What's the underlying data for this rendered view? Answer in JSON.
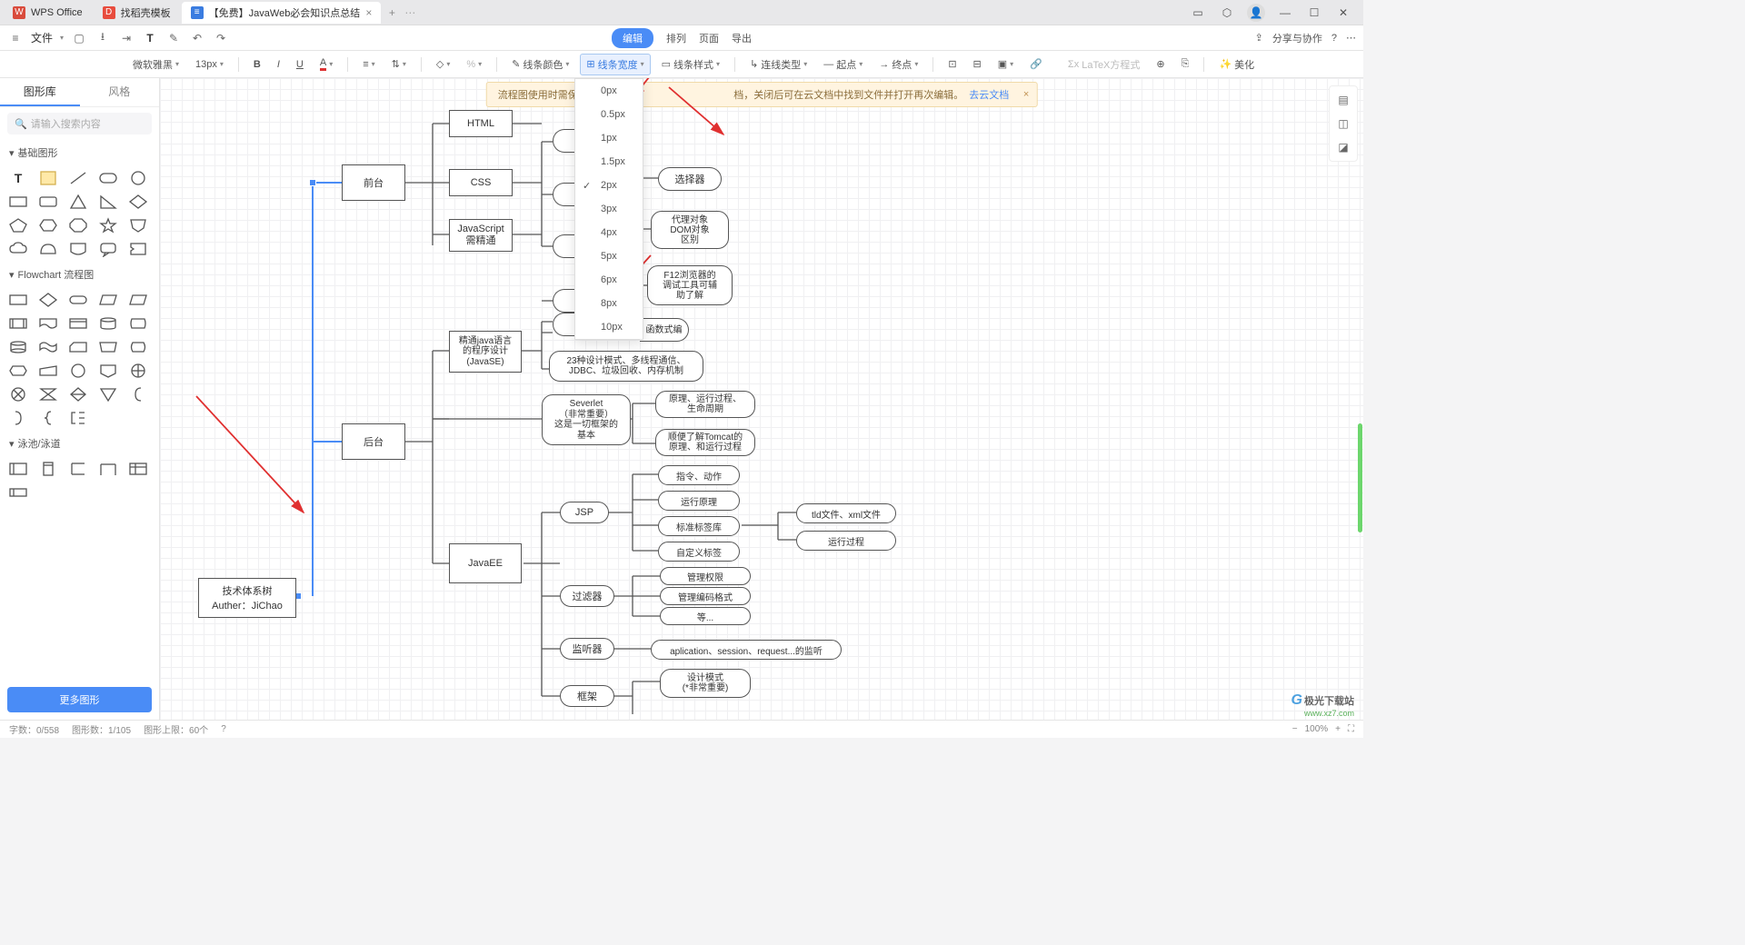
{
  "tabs": [
    {
      "icon_bg": "#d94b3c",
      "icon_text": "W",
      "label": "WPS Office"
    },
    {
      "icon_bg": "#e84c3d",
      "icon_text": "D",
      "label": "找稻壳模板"
    },
    {
      "icon_bg": "#3a7ce0",
      "icon_text": "≡",
      "label": "【免费】JavaWeb必会知识点总结"
    }
  ],
  "menubar": {
    "file": "文件",
    "center": {
      "edit": "编辑",
      "arrange": "排列",
      "page": "页面",
      "export": "导出"
    },
    "right": {
      "share": "分享与协作"
    }
  },
  "toolbar": {
    "font": "微软雅黑",
    "size": "13px",
    "line_color": "线条颜色",
    "line_width": "线条宽度",
    "line_style": "线条样式",
    "conn_type": "连线类型",
    "start": "起点",
    "end": "终点",
    "latex": "LaTeX方程式",
    "beautify": "美化"
  },
  "line_width_options": [
    "0px",
    "0.5px",
    "1px",
    "1.5px",
    "2px",
    "3px",
    "4px",
    "5px",
    "6px",
    "8px",
    "10px"
  ],
  "line_width_selected": "2px",
  "sidebar": {
    "tab_shapes": "图形库",
    "tab_style": "风格",
    "search_placeholder": "请输入搜索内容",
    "section_basic": "基础图形",
    "section_flowchart": "Flowchart 流程图",
    "section_swimlane": "泳池/泳道",
    "more": "更多图形"
  },
  "banner": {
    "text_a": "流程图使用时需保持联网，内容",
    "text_b": "档，关闭后可在云文档中找到文件并打开再次编辑。",
    "link": "去云文档"
  },
  "nodes": {
    "root": "技术体系树\nAuther：JiChao",
    "front": "前台",
    "back": "后台",
    "html": "HTML",
    "css": "CSS",
    "js": "JavaScript\n需精通",
    "selector": "选择器",
    "proxy": "代理对象\nDOM对象\n区别",
    "f12": "F12浏览器的\n调试工具可辅\n助了解",
    "fx": "函数式编",
    "java_se": "精通java语言\n的程序设计\n(JavaSE)",
    "patterns": "23种设计模式、多线程通信、\nJDBC、垃圾回收、内存机制",
    "servlet": "Severlet\n（非常重要）\n这是一切框架的\n基本",
    "servlet_a": "原理、运行过程、\n生命周期",
    "servlet_b": "顺便了解Tomcat的\n原理、和运行过程",
    "jsp": "JSP",
    "jsp_a": "指令、动作",
    "jsp_b": "运行原理",
    "jsp_c": "标准标签库",
    "jsp_d": "自定义标签",
    "javaee": "JavaEE",
    "tld": "tld文件、xml文件",
    "runproc": "运行过程",
    "filter": "过滤器",
    "filter_a": "管理权限",
    "filter_b": "管理编码格式",
    "filter_c": "等...",
    "listener": "监听器",
    "listener_a": "aplication、session、request...的监听",
    "framework": "框架",
    "framework_a": "设计模式\n(*非常重要)"
  },
  "status": {
    "chars": "字数：0/558",
    "shapes": "图形数：1/105",
    "limit": "图形上限：60个",
    "zoom": "100%"
  },
  "watermark": {
    "brand": "极光下载站",
    "url": "www.xz7.com"
  }
}
